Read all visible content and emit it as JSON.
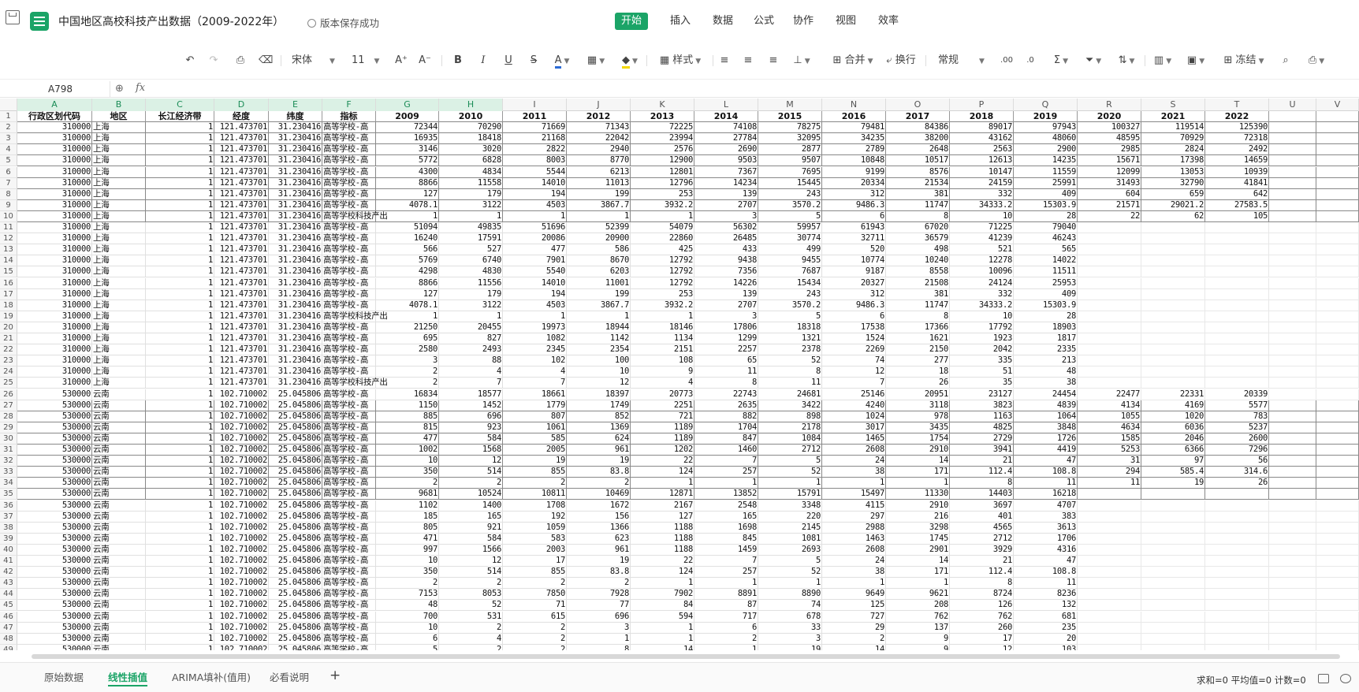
{
  "window": {
    "title": "中国地区高校科技产出数据（2009-2022年）",
    "save_status": "版本保存成功",
    "app_icon": "spreadsheet-icon"
  },
  "menu_tabs": [
    {
      "label": "开始",
      "active": true
    },
    {
      "label": "插入",
      "active": false
    },
    {
      "label": "数据",
      "active": false
    },
    {
      "label": "公式",
      "active": false
    },
    {
      "label": "协作",
      "active": false
    },
    {
      "label": "视图",
      "active": false
    },
    {
      "label": "效率",
      "active": false
    }
  ],
  "toolbar": {
    "font_name": "宋体",
    "font_size": "11",
    "bold": "B",
    "italic": "I",
    "underline": "U",
    "strike": "S",
    "font_color": "A",
    "style_label": "样式",
    "merge_label": "合并",
    "wrap_label": "换行",
    "number_format": "常规",
    "sum_symbol": "Σ",
    "freeze_label": "冻结",
    "decimal_add": ".00",
    "decimal_remove": ".0"
  },
  "formula_bar": {
    "name_box": "A798",
    "fx": "fx",
    "value": ""
  },
  "columns": [
    "A",
    "B",
    "C",
    "D",
    "E",
    "F",
    "G",
    "H",
    "I",
    "J",
    "K",
    "L",
    "M",
    "N",
    "O",
    "P",
    "Q",
    "R",
    "S",
    "T",
    "U",
    "V"
  ],
  "header_row": [
    "行政区划代码",
    "地区",
    "长江经济带",
    "经度",
    "纬度",
    "指标",
    "2009",
    "2010",
    "2011",
    "2012",
    "2013",
    "2014",
    "2015",
    "2016",
    "2017",
    "2018",
    "2019",
    "2020",
    "2021",
    "2022"
  ],
  "rows": [
    [
      "310000",
      "上海",
      "1",
      "121.473701",
      "31.230416",
      "高等学校-高",
      "72344",
      "70290",
      "71669",
      "71343",
      "72225",
      "74108",
      "78275",
      "79481",
      "84386",
      "89017",
      "97943",
      "100327",
      "119514",
      "125390"
    ],
    [
      "310000",
      "上海",
      "1",
      "121.473701",
      "31.230416",
      "高等学校-高",
      "16935",
      "18418",
      "21168",
      "22042",
      "23994",
      "27784",
      "32095",
      "34235",
      "38200",
      "43162",
      "48060",
      "48595",
      "70929",
      "72318"
    ],
    [
      "310000",
      "上海",
      "1",
      "121.473701",
      "31.230416",
      "高等学校-高",
      "3146",
      "3020",
      "2822",
      "2940",
      "2576",
      "2690",
      "2877",
      "2789",
      "2648",
      "2563",
      "2900",
      "2985",
      "2824",
      "2492"
    ],
    [
      "310000",
      "上海",
      "1",
      "121.473701",
      "31.230416",
      "高等学校-高",
      "5772",
      "6828",
      "8003",
      "8770",
      "12900",
      "9503",
      "9507",
      "10848",
      "10517",
      "12613",
      "14235",
      "15671",
      "17398",
      "14659"
    ],
    [
      "310000",
      "上海",
      "1",
      "121.473701",
      "31.230416",
      "高等学校-高",
      "4300",
      "4834",
      "5544",
      "6213",
      "12801",
      "7367",
      "7695",
      "9199",
      "8576",
      "10147",
      "11559",
      "12099",
      "13053",
      "10939"
    ],
    [
      "310000",
      "上海",
      "1",
      "121.473701",
      "31.230416",
      "高等学校-高",
      "8866",
      "11558",
      "14010",
      "11013",
      "12796",
      "14234",
      "15445",
      "20334",
      "21534",
      "24159",
      "25991",
      "31493",
      "32790",
      "41841"
    ],
    [
      "310000",
      "上海",
      "1",
      "121.473701",
      "31.230416",
      "高等学校-高",
      "127",
      "179",
      "194",
      "199",
      "253",
      "139",
      "243",
      "312",
      "381",
      "332",
      "409",
      "604",
      "659",
      "642"
    ],
    [
      "310000",
      "上海",
      "1",
      "121.473701",
      "31.230416",
      "高等学校-高",
      "4078.1",
      "3122",
      "4503",
      "3867.7",
      "3932.2",
      "2707",
      "3570.2",
      "9486.3",
      "11747",
      "34333.2",
      "15303.9",
      "21571",
      "29021.2",
      "27583.5"
    ],
    [
      "310000",
      "上海",
      "1",
      "121.473701",
      "31.230416",
      "高等学校科技产出",
      "1",
      "1",
      "1",
      "1",
      "1",
      "3",
      "5",
      "6",
      "8",
      "10",
      "28",
      "22",
      "62",
      "105"
    ],
    [
      "310000",
      "上海",
      "1",
      "121.473701",
      "31.230416",
      "高等学校-高",
      "51094",
      "49835",
      "51696",
      "52399",
      "54079",
      "56302",
      "59957",
      "61943",
      "67020",
      "71225",
      "79040",
      "",
      "",
      ""
    ],
    [
      "310000",
      "上海",
      "1",
      "121.473701",
      "31.230416",
      "高等学校-高",
      "16240",
      "17591",
      "20086",
      "20900",
      "22860",
      "26485",
      "30774",
      "32711",
      "36579",
      "41239",
      "46243",
      "",
      "",
      ""
    ],
    [
      "310000",
      "上海",
      "1",
      "121.473701",
      "31.230416",
      "高等学校-高",
      "566",
      "527",
      "477",
      "586",
      "425",
      "433",
      "499",
      "520",
      "498",
      "521",
      "565",
      "",
      "",
      ""
    ],
    [
      "310000",
      "上海",
      "1",
      "121.473701",
      "31.230416",
      "高等学校-高",
      "5769",
      "6740",
      "7901",
      "8670",
      "12792",
      "9438",
      "9455",
      "10774",
      "10240",
      "12278",
      "14022",
      "",
      "",
      ""
    ],
    [
      "310000",
      "上海",
      "1",
      "121.473701",
      "31.230416",
      "高等学校-高",
      "4298",
      "4830",
      "5540",
      "6203",
      "12792",
      "7356",
      "7687",
      "9187",
      "8558",
      "10096",
      "11511",
      "",
      "",
      ""
    ],
    [
      "310000",
      "上海",
      "1",
      "121.473701",
      "31.230416",
      "高等学校-高",
      "8866",
      "11556",
      "14010",
      "11001",
      "12792",
      "14226",
      "15434",
      "20327",
      "21508",
      "24124",
      "25953",
      "",
      "",
      ""
    ],
    [
      "310000",
      "上海",
      "1",
      "121.473701",
      "31.230416",
      "高等学校-高",
      "127",
      "179",
      "194",
      "199",
      "253",
      "139",
      "243",
      "312",
      "381",
      "332",
      "409",
      "",
      "",
      ""
    ],
    [
      "310000",
      "上海",
      "1",
      "121.473701",
      "31.230416",
      "高等学校-高",
      "4078.1",
      "3122",
      "4503",
      "3867.7",
      "3932.2",
      "2707",
      "3570.2",
      "9486.3",
      "11747",
      "34333.2",
      "15303.9",
      "",
      "",
      ""
    ],
    [
      "310000",
      "上海",
      "1",
      "121.473701",
      "31.230416",
      "高等学校科技产出",
      "1",
      "1",
      "1",
      "1",
      "1",
      "3",
      "5",
      "6",
      "8",
      "10",
      "28",
      "",
      "",
      ""
    ],
    [
      "310000",
      "上海",
      "1",
      "121.473701",
      "31.230416",
      "高等学校-高",
      "21250",
      "20455",
      "19973",
      "18944",
      "18146",
      "17806",
      "18318",
      "17538",
      "17366",
      "17792",
      "18903",
      "",
      "",
      ""
    ],
    [
      "310000",
      "上海",
      "1",
      "121.473701",
      "31.230416",
      "高等学校-高",
      "695",
      "827",
      "1082",
      "1142",
      "1134",
      "1299",
      "1321",
      "1524",
      "1621",
      "1923",
      "1817",
      "",
      "",
      ""
    ],
    [
      "310000",
      "上海",
      "1",
      "121.473701",
      "31.230416",
      "高等学校-高",
      "2580",
      "2493",
      "2345",
      "2354",
      "2151",
      "2257",
      "2378",
      "2269",
      "2150",
      "2042",
      "2335",
      "",
      "",
      ""
    ],
    [
      "310000",
      "上海",
      "1",
      "121.473701",
      "31.230416",
      "高等学校-高",
      "3",
      "88",
      "102",
      "100",
      "108",
      "65",
      "52",
      "74",
      "277",
      "335",
      "213",
      "",
      "",
      ""
    ],
    [
      "310000",
      "上海",
      "1",
      "121.473701",
      "31.230416",
      "高等学校-高",
      "2",
      "4",
      "4",
      "10",
      "9",
      "11",
      "8",
      "12",
      "18",
      "51",
      "48",
      "",
      "",
      ""
    ],
    [
      "310000",
      "上海",
      "1",
      "121.473701",
      "31.230416",
      "高等学校科技产出",
      "2",
      "7",
      "7",
      "12",
      "4",
      "8",
      "11",
      "7",
      "26",
      "35",
      "38",
      "",
      "",
      ""
    ],
    [
      "530000",
      "云南",
      "1",
      "102.710002",
      "25.045806",
      "高等学校-高",
      "16834",
      "18577",
      "18661",
      "18397",
      "20773",
      "22743",
      "24681",
      "25146",
      "20951",
      "23127",
      "24454",
      "22477",
      "22331",
      "20339"
    ],
    [
      "530000",
      "云南",
      "1",
      "102.710002",
      "25.045806",
      "高等学校-高",
      "1150",
      "1452",
      "1779",
      "1749",
      "2251",
      "2635",
      "3422",
      "4240",
      "3118",
      "3823",
      "4839",
      "4134",
      "4169",
      "5577"
    ],
    [
      "530000",
      "云南",
      "1",
      "102.710002",
      "25.045806",
      "高等学校-高",
      "885",
      "696",
      "807",
      "852",
      "721",
      "882",
      "898",
      "1024",
      "978",
      "1163",
      "1064",
      "1055",
      "1020",
      "783"
    ],
    [
      "530000",
      "云南",
      "1",
      "102.710002",
      "25.045806",
      "高等学校-高",
      "815",
      "923",
      "1061",
      "1369",
      "1189",
      "1704",
      "2178",
      "3017",
      "3435",
      "4825",
      "3848",
      "4634",
      "6036",
      "5237"
    ],
    [
      "530000",
      "云南",
      "1",
      "102.710002",
      "25.045806",
      "高等学校-高",
      "477",
      "584",
      "585",
      "624",
      "1189",
      "847",
      "1084",
      "1465",
      "1754",
      "2729",
      "1726",
      "1585",
      "2046",
      "2600"
    ],
    [
      "530000",
      "云南",
      "1",
      "102.710002",
      "25.045806",
      "高等学校-高",
      "1002",
      "1568",
      "2005",
      "961",
      "1202",
      "1460",
      "2712",
      "2608",
      "2910",
      "3941",
      "4419",
      "5253",
      "6366",
      "7296"
    ],
    [
      "530000",
      "云南",
      "1",
      "102.710002",
      "25.045806",
      "高等学校-高",
      "10",
      "12",
      "19",
      "19",
      "22",
      "7",
      "5",
      "24",
      "14",
      "21",
      "47",
      "31",
      "97",
      "56"
    ],
    [
      "530000",
      "云南",
      "1",
      "102.710002",
      "25.045806",
      "高等学校-高",
      "350",
      "514",
      "855",
      "83.8",
      "124",
      "257",
      "52",
      "38",
      "171",
      "112.4",
      "108.8",
      "294",
      "585.4",
      "314.6"
    ],
    [
      "530000",
      "云南",
      "1",
      "102.710002",
      "25.045806",
      "高等学校-高",
      "2",
      "2",
      "2",
      "2",
      "1",
      "1",
      "1",
      "1",
      "1",
      "8",
      "11",
      "11",
      "19",
      "26"
    ],
    [
      "530000",
      "云南",
      "1",
      "102.710002",
      "25.045806",
      "高等学校-高",
      "9681",
      "10524",
      "10811",
      "10469",
      "12871",
      "13852",
      "15791",
      "15497",
      "11330",
      "14403",
      "16218",
      "",
      "",
      ""
    ],
    [
      "530000",
      "云南",
      "1",
      "102.710002",
      "25.045806",
      "高等学校-高",
      "1102",
      "1400",
      "1708",
      "1672",
      "2167",
      "2548",
      "3348",
      "4115",
      "2910",
      "3697",
      "4707",
      "",
      "",
      ""
    ],
    [
      "530000",
      "云南",
      "1",
      "102.710002",
      "25.045806",
      "高等学校-高",
      "185",
      "165",
      "192",
      "156",
      "127",
      "165",
      "220",
      "297",
      "216",
      "401",
      "383",
      "",
      "",
      ""
    ],
    [
      "530000",
      "云南",
      "1",
      "102.710002",
      "25.045806",
      "高等学校-高",
      "805",
      "921",
      "1059",
      "1366",
      "1188",
      "1698",
      "2145",
      "2988",
      "3298",
      "4565",
      "3613",
      "",
      "",
      ""
    ],
    [
      "530000",
      "云南",
      "1",
      "102.710002",
      "25.045806",
      "高等学校-高",
      "471",
      "584",
      "583",
      "623",
      "1188",
      "845",
      "1081",
      "1463",
      "1745",
      "2712",
      "1706",
      "",
      "",
      ""
    ],
    [
      "530000",
      "云南",
      "1",
      "102.710002",
      "25.045806",
      "高等学校-高",
      "997",
      "1566",
      "2003",
      "961",
      "1188",
      "1459",
      "2693",
      "2608",
      "2901",
      "3929",
      "4316",
      "",
      "",
      ""
    ],
    [
      "530000",
      "云南",
      "1",
      "102.710002",
      "25.045806",
      "高等学校-高",
      "10",
      "12",
      "17",
      "19",
      "22",
      "7",
      "5",
      "24",
      "14",
      "21",
      "47",
      "",
      "",
      ""
    ],
    [
      "530000",
      "云南",
      "1",
      "102.710002",
      "25.045806",
      "高等学校-高",
      "350",
      "514",
      "855",
      "83.8",
      "124",
      "257",
      "52",
      "38",
      "171",
      "112.4",
      "108.8",
      "",
      "",
      ""
    ],
    [
      "530000",
      "云南",
      "1",
      "102.710002",
      "25.045806",
      "高等学校-高",
      "2",
      "2",
      "2",
      "2",
      "1",
      "1",
      "1",
      "1",
      "1",
      "8",
      "11",
      "",
      "",
      ""
    ],
    [
      "530000",
      "云南",
      "1",
      "102.710002",
      "25.045806",
      "高等学校-高",
      "7153",
      "8053",
      "7850",
      "7928",
      "7902",
      "8891",
      "8890",
      "9649",
      "9621",
      "8724",
      "8236",
      "",
      "",
      ""
    ],
    [
      "530000",
      "云南",
      "1",
      "102.710002",
      "25.045806",
      "高等学校-高",
      "48",
      "52",
      "71",
      "77",
      "84",
      "87",
      "74",
      "125",
      "208",
      "126",
      "132",
      "",
      "",
      ""
    ],
    [
      "530000",
      "云南",
      "1",
      "102.710002",
      "25.045806",
      "高等学校-高",
      "700",
      "531",
      "615",
      "696",
      "594",
      "717",
      "678",
      "727",
      "762",
      "762",
      "681",
      "",
      "",
      ""
    ],
    [
      "530000",
      "云南",
      "1",
      "102.710002",
      "25.045806",
      "高等学校-高",
      "10",
      "2",
      "2",
      "3",
      "1",
      "6",
      "33",
      "29",
      "137",
      "260",
      "235",
      "",
      "",
      ""
    ],
    [
      "530000",
      "云南",
      "1",
      "102.710002",
      "25.045806",
      "高等学校-高",
      "6",
      "4",
      "2",
      "1",
      "1",
      "2",
      "3",
      "2",
      "9",
      "17",
      "20",
      "",
      "",
      ""
    ],
    [
      "530000",
      "云南",
      "1",
      "102.710002",
      "25.045806",
      "高等学校-高",
      "5",
      "2",
      "2",
      "8",
      "14",
      "1",
      "19",
      "14",
      "9",
      "12",
      "103",
      "",
      "",
      ""
    ]
  ],
  "sheet_tabs": [
    {
      "label": "原始数据",
      "active": false
    },
    {
      "label": "线性插值",
      "active": true
    },
    {
      "label": "ARIMA填补(值用)",
      "active": false
    },
    {
      "label": "必看说明",
      "active": false
    }
  ],
  "status_bar": {
    "summary": "求和=0  平均值=0  计数=0"
  },
  "colors": {
    "accent": "#1ba467",
    "header_highlight": "#dbf1e5"
  }
}
